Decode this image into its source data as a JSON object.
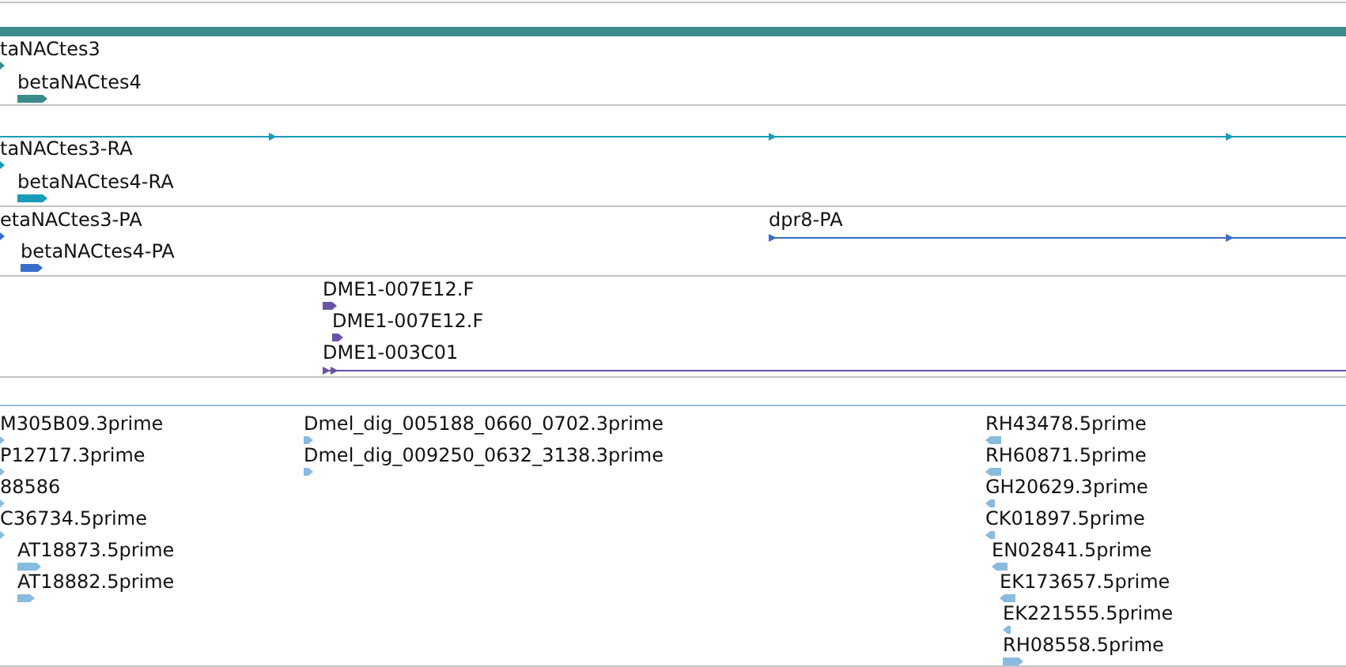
{
  "tracks": [
    {
      "kind": "features",
      "color": "#3d8c8c",
      "bar": true,
      "features": [
        {
          "label": "taNACtes3",
          "kind": "block",
          "reverse": false
        },
        {
          "label": "betaNACtes4",
          "kind": "block",
          "reverse": false
        }
      ]
    },
    {
      "kind": "features",
      "color": "#1a9cb8",
      "through_line": true,
      "features": [
        {
          "label": "taNACtes3-RA",
          "kind": "block",
          "reverse": false
        },
        {
          "label": "betaNACtes4-RA",
          "kind": "block",
          "reverse": false
        }
      ]
    },
    {
      "kind": "features",
      "color": "#3a6cc8",
      "features": [
        {
          "label": "etaNACtes3-PA",
          "kind": "block",
          "reverse": false
        },
        {
          "label": "betaNACtes4-PA",
          "kind": "block",
          "reverse": false
        },
        {
          "label": "dpr8-PA",
          "kind": "transcript",
          "reverse": false
        }
      ]
    },
    {
      "kind": "features",
      "color": "#6a52a8",
      "features": [
        {
          "label": "DME1-007E12.F",
          "kind": "block",
          "reverse": false
        },
        {
          "label": "DME1-007E12.F",
          "kind": "block",
          "reverse": false
        },
        {
          "label": "DME1-003C01",
          "kind": "transcript",
          "reverse": false
        }
      ]
    },
    {
      "kind": "empty"
    },
    {
      "kind": "features",
      "color": "#88bbdd",
      "features": [
        {
          "label": "M305B09.3prime",
          "kind": "block",
          "reverse": false
        },
        {
          "label": "P12717.3prime",
          "kind": "block",
          "reverse": false
        },
        {
          "label": "88586",
          "kind": "block",
          "reverse": false
        },
        {
          "label": "C36734.5prime",
          "kind": "block",
          "reverse": false
        },
        {
          "label": "AT18873.5prime",
          "kind": "block",
          "reverse": false
        },
        {
          "label": "AT18882.5prime",
          "kind": "block",
          "reverse": false
        },
        {
          "label": "Dmel_dig_005188_0660_0702.3prime",
          "kind": "block",
          "reverse": false
        },
        {
          "label": "Dmel_dig_009250_0632_3138.3prime",
          "kind": "block",
          "reverse": false
        },
        {
          "label": "RH43478.5prime",
          "kind": "block",
          "reverse": true
        },
        {
          "label": "RH60871.5prime",
          "kind": "block",
          "reverse": true
        },
        {
          "label": "GH20629.3prime",
          "kind": "block",
          "reverse": true
        },
        {
          "label": "CK01897.5prime",
          "kind": "block",
          "reverse": true
        },
        {
          "label": "EN02841.5prime",
          "kind": "block",
          "reverse": true
        },
        {
          "label": "EK173657.5prime",
          "kind": "block",
          "reverse": true
        },
        {
          "label": "EK221555.5prime",
          "kind": "block",
          "reverse": true
        },
        {
          "label": "RH08558.5prime",
          "kind": "block",
          "reverse": false
        }
      ]
    }
  ]
}
